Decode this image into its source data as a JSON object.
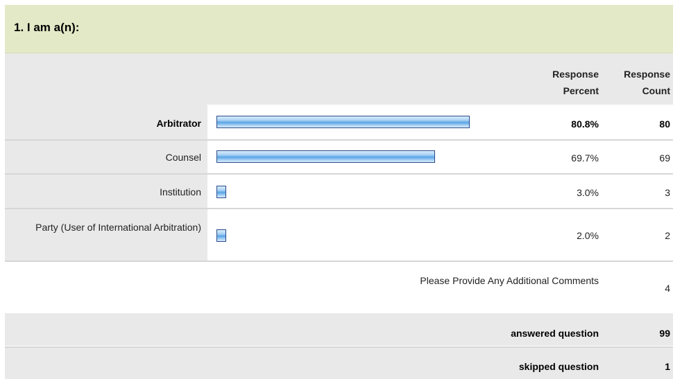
{
  "question": {
    "title": "1. I am a(n):"
  },
  "header": {
    "response_percent": "Response Percent",
    "response_count": "Response Count"
  },
  "chart_data": {
    "type": "bar",
    "orientation": "horizontal",
    "categories": [
      "Arbitrator",
      "Counsel",
      "Institution",
      "Party (User of International Arbitration)"
    ],
    "values": [
      80.8,
      69.7,
      3.0,
      2.0
    ],
    "counts": [
      80,
      69,
      3,
      2
    ],
    "xlim": [
      0,
      100
    ]
  },
  "rows": [
    {
      "label": "Arbitrator",
      "percent": "80.8%",
      "count": "80"
    },
    {
      "label": "Counsel",
      "percent": "69.7%",
      "count": "69"
    },
    {
      "label": "Institution",
      "percent": "3.0%",
      "count": "3"
    },
    {
      "label": "Party (User of International Arbitration)",
      "percent": "2.0%",
      "count": "2"
    }
  ],
  "comments": {
    "label": "Please Provide Any Additional Comments",
    "count": "4"
  },
  "summary": {
    "answered_label": "answered question",
    "answered_count": "99",
    "skipped_label": "skipped question",
    "skipped_count": "1"
  }
}
